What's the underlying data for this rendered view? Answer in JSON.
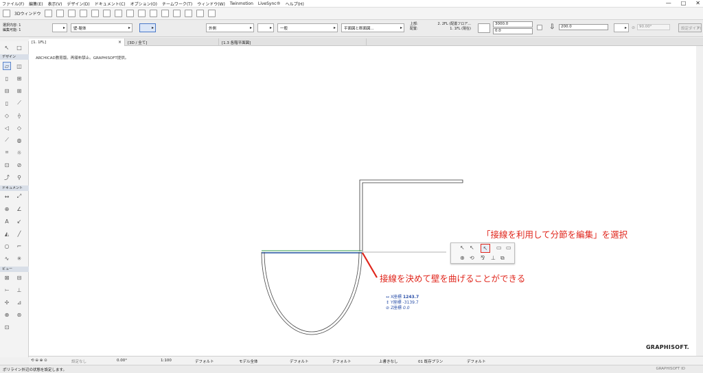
{
  "menu": [
    "ファイル(F)",
    "編集(E)",
    "表示(V)",
    "デザイン(D)",
    "ドキュメント(C)",
    "オプション(O)",
    "チームワーク(T)",
    "ウィンドウ(W)",
    "Twinmotion",
    "LiveSync®",
    "ヘルプ(H)"
  ],
  "window_controls": [
    "—",
    "□",
    "✕"
  ],
  "toolbar": {
    "view3d_label": "3Dウィンドウ"
  },
  "info_box": {
    "line1": "選択内容: 1",
    "line2": "編集可能: 1",
    "layer": "壁-躯体",
    "exterior": "外側",
    "composite": "一般",
    "floorplan_display": "平面図と断面図...",
    "top_label": "上部:",
    "top_value": "2. 2FL (配置フロア...",
    "base_label": "配置:",
    "base_value": "1. 1FL (現在)",
    "height": "3000.0",
    "offset": "0.0",
    "thickness": "200.0",
    "angle": "90.00°",
    "tab_right": "設定ダイアログ"
  },
  "tabs": [
    {
      "label": "[1. 1FL]",
      "close": "×"
    },
    {
      "label": "[3D / 全て]"
    },
    {
      "label": "[1.3 各階平面図]"
    }
  ],
  "toolbox": {
    "section_design": "デザイン",
    "section_document": "ドキュメント",
    "section_view": "ビュー"
  },
  "canvas": {
    "notice": "ARCHICAD教育版。再頒布禁止。GRAPHISOFT提供。",
    "logo": "GRAPHISOFT."
  },
  "annotations": {
    "select_hint": "「接線を利用して分節を編集」を選択",
    "curve_hint": "接線を決めて壁を曲げることができる"
  },
  "coordinates": {
    "x_label": "X座標",
    "x_value": "1243.7",
    "y_label": "Y座標",
    "y_value": "-3139.7",
    "z_label": "Z座標",
    "z_value": "0.0"
  },
  "statusbar": {
    "undo_label": "設定なし",
    "angle": "0.00°",
    "scale": "1:100",
    "layer_combo": "デフォルト",
    "model_view": "モデル全体",
    "pen_set": "デフォルト",
    "dim": "デフォルト",
    "override": "上書きなし",
    "renovation": "01 既存プラン",
    "graphic": "デフォルト"
  },
  "footer": {
    "hint": "ポリライン外辺の状態を設定します。",
    "brand": "GRAPHISOFT ID"
  },
  "colors": {
    "accent_red": "#e0261c",
    "coord_blue": "#2a4fa8",
    "wall_green": "#2f9a4a"
  }
}
